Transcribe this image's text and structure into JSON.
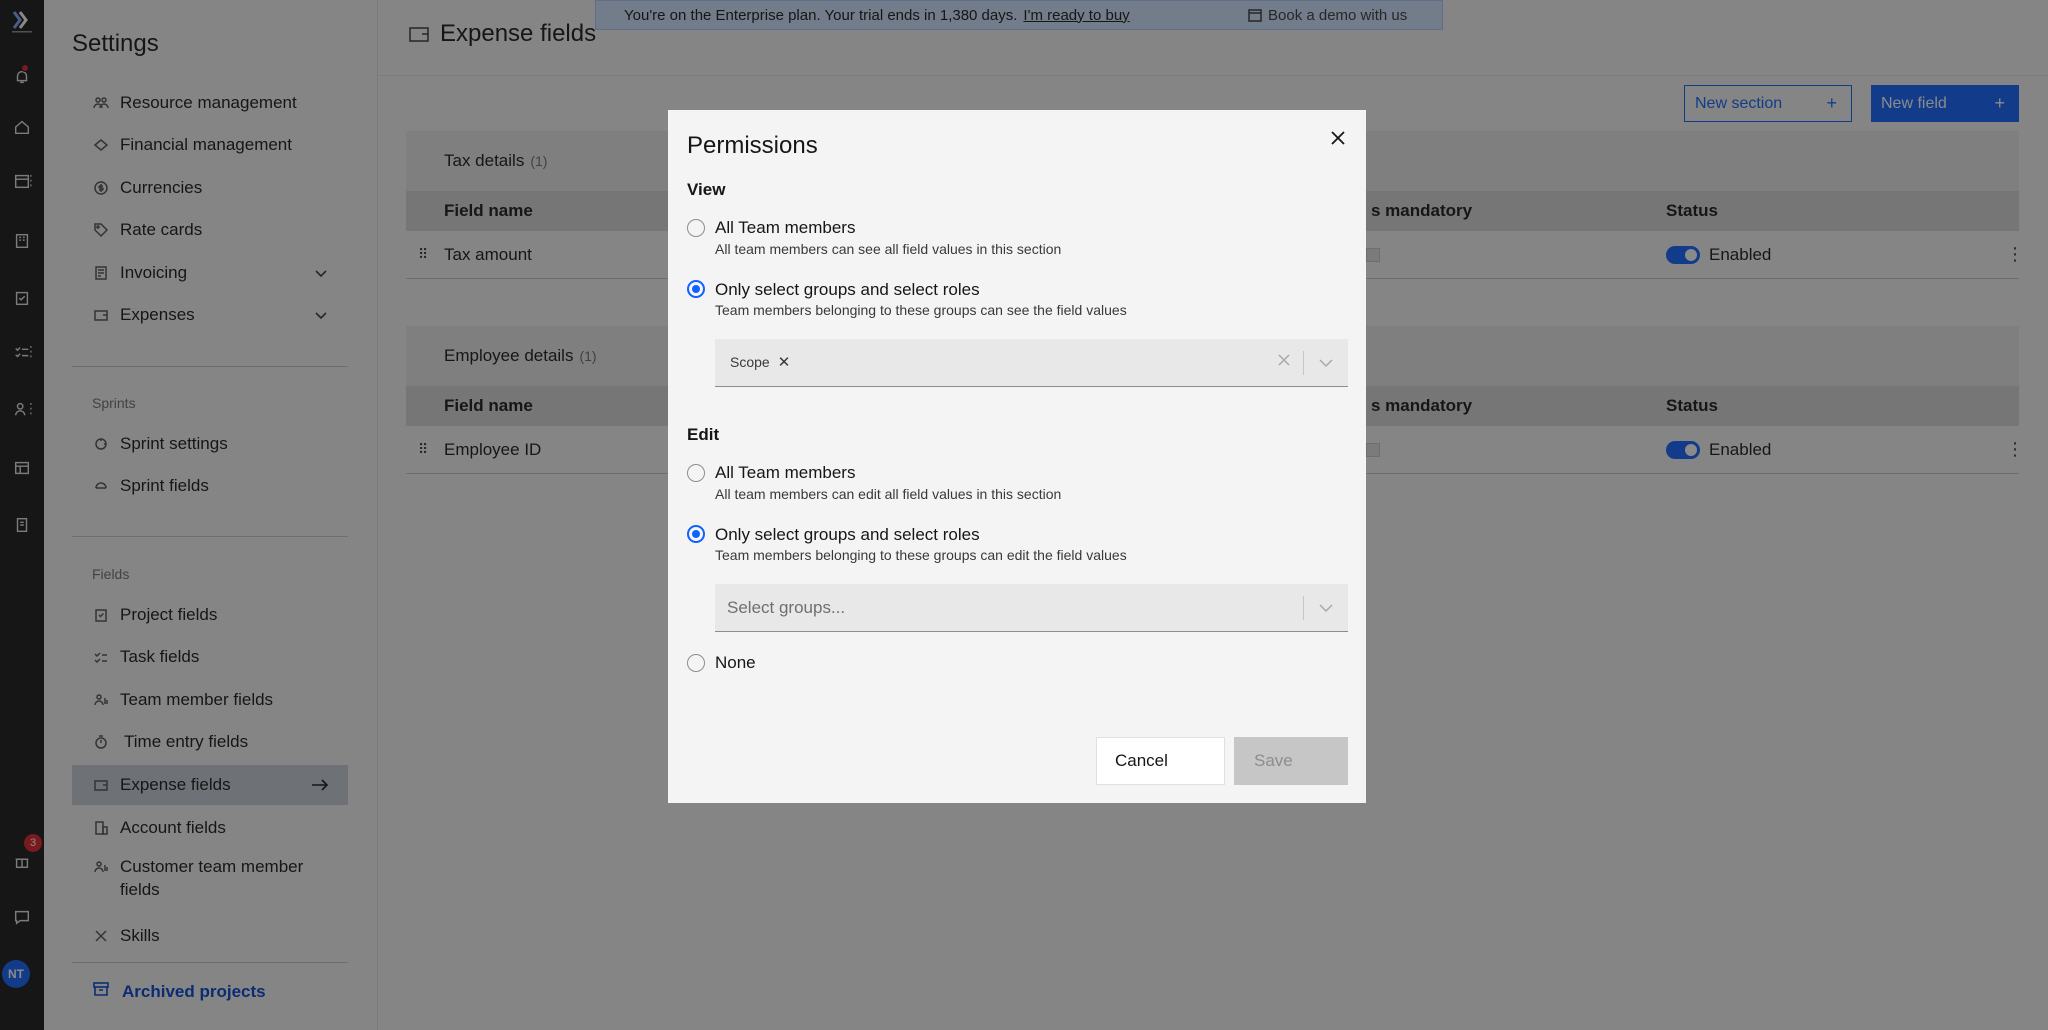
{
  "rail": {
    "notification_count": "3",
    "avatar_initials": "NT"
  },
  "settings": {
    "title": "Settings",
    "items_top": [
      {
        "label": "Resource management",
        "icon": "people-icon"
      },
      {
        "label": "Financial management",
        "icon": "money-icon"
      },
      {
        "label": "Currencies",
        "icon": "currency-icon"
      },
      {
        "label": "Rate cards",
        "icon": "tag-icon"
      },
      {
        "label": "Invoicing",
        "icon": "invoice-icon"
      },
      {
        "label": "Expenses",
        "icon": "wallet-icon"
      }
    ],
    "sprints_label": "Sprints",
    "sprint_items": [
      {
        "label": "Sprint settings"
      },
      {
        "label": "Sprint fields"
      }
    ],
    "fields_label": "Fields",
    "field_items": [
      {
        "label": "Project fields"
      },
      {
        "label": "Task fields"
      },
      {
        "label": "Team member fields"
      },
      {
        "label": "Time entry fields"
      },
      {
        "label": "Expense fields"
      },
      {
        "label": "Account fields"
      },
      {
        "label": "Customer team member fields"
      },
      {
        "label": "Skills"
      }
    ],
    "archived_label": "Archived projects"
  },
  "header": {
    "page_title": "Expense fields",
    "banner_message": "You're on the Enterprise plan. Your trial ends in 1,380 days.",
    "banner_buy": "I'm ready to buy",
    "banner_demo": "Book a demo with us"
  },
  "toolbar": {
    "new_section": "New section",
    "new_field": "New field",
    "plus": "+"
  },
  "groups": [
    {
      "title": "Tax details",
      "count": "(1)",
      "col_field_name": "Field name",
      "col_mandatory": "s mandatory",
      "col_status": "Status",
      "rows": [
        {
          "name": "Tax amount",
          "status": "Enabled"
        }
      ]
    },
    {
      "title": "Employee details",
      "count": "(1)",
      "col_field_name": "Field name",
      "col_mandatory": "s mandatory",
      "col_status": "Status",
      "rows": [
        {
          "name": "Employee ID",
          "status": "Enabled"
        }
      ]
    }
  ],
  "modal": {
    "title": "Permissions",
    "view": {
      "label": "View",
      "opt_all_title": "All Team members",
      "opt_all_desc": "All team members can see all field values in this section",
      "opt_select_title": "Only select groups and select roles",
      "opt_select_desc": "Team members belonging to these groups can see the field values",
      "tag": "Scope"
    },
    "edit": {
      "label": "Edit",
      "opt_all_title": "All Team members",
      "opt_all_desc": "All team members can edit all field values in this section",
      "opt_select_title": "Only select groups and select roles",
      "opt_select_desc": "Team members belonging to these groups can edit the field values",
      "placeholder": "Select groups...",
      "opt_none_title": "None"
    },
    "cancel": "Cancel",
    "save": "Save"
  },
  "colors": {
    "primary": "#0f62fe",
    "rail_bg": "#161616",
    "active_nav": "#c6ccd7",
    "banner_bg": "#d0e2ff"
  }
}
